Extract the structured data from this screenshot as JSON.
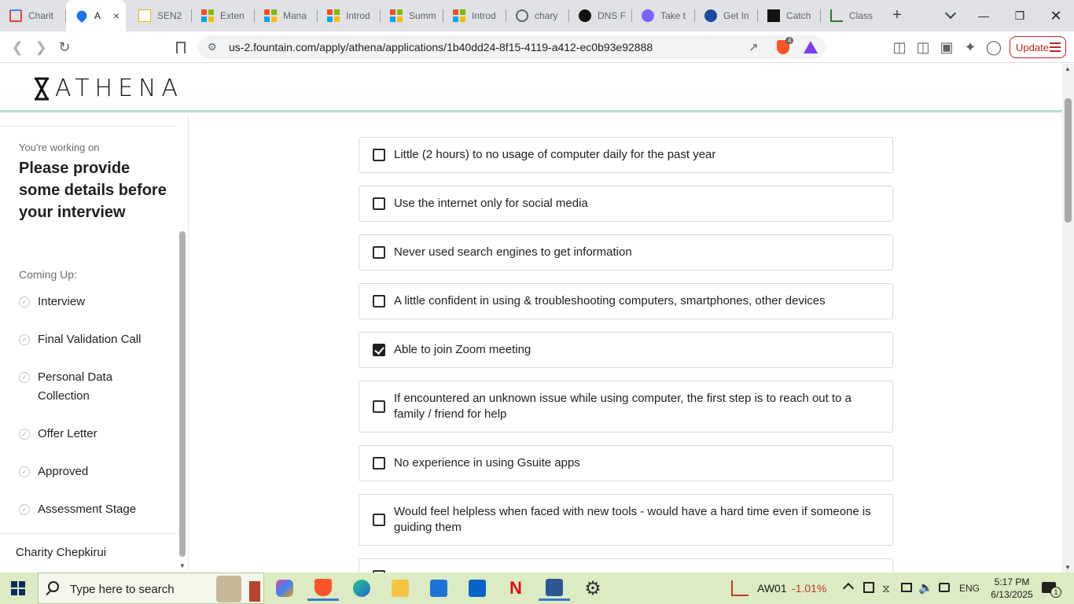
{
  "browser": {
    "tabs": [
      {
        "title": "Charit",
        "icon": "gmail-icon",
        "active": false
      },
      {
        "title": "A",
        "icon": "fountain-icon",
        "active": true
      },
      {
        "title": "SEN2",
        "icon": "slides-icon",
        "active": false
      },
      {
        "title": "Exten",
        "icon": "microsoft-icon",
        "active": false
      },
      {
        "title": "Mana",
        "icon": "microsoft-icon",
        "active": false
      },
      {
        "title": "Introd",
        "icon": "microsoft-icon",
        "active": false
      },
      {
        "title": "Summ",
        "icon": "microsoft-icon",
        "active": false
      },
      {
        "title": "Introd",
        "icon": "microsoft-icon",
        "active": false
      },
      {
        "title": "chary",
        "icon": "globe-icon",
        "active": false
      },
      {
        "title": "DNS F",
        "icon": "openai-icon",
        "active": false
      },
      {
        "title": "Take t",
        "icon": "purple-circle-icon",
        "active": false
      },
      {
        "title": "Get In",
        "icon": "edge-icon",
        "active": false
      },
      {
        "title": "Catch",
        "icon": "catch-icon",
        "active": false
      },
      {
        "title": "Class",
        "icon": "chart-icon",
        "active": false
      }
    ],
    "url": "us-2.fountain.com/apply/athena/applications/1b40dd24-8f15-4119-a412-ec0b93e92888",
    "update_label": "Update",
    "brave_badge": "4",
    "new_tab": "+",
    "close_tab": "×"
  },
  "site": {
    "logo_text": "ATHENA"
  },
  "sidebar": {
    "working_label": "You're working on",
    "working_title": "Please provide some details before your interview",
    "coming_label": "Coming Up:",
    "steps": [
      {
        "label": "Interview"
      },
      {
        "label": "Final Validation Call"
      },
      {
        "label": "Personal Data Collection"
      },
      {
        "label": "Offer Letter"
      },
      {
        "label": "Approved"
      },
      {
        "label": "Assessment Stage"
      }
    ],
    "user_name": "Charity Chepkirui"
  },
  "options": [
    {
      "label": "Little (2 hours) to no usage of computer daily for the past year",
      "checked": false
    },
    {
      "label": "Use the internet only for social media",
      "checked": false
    },
    {
      "label": "Never used search engines to get information",
      "checked": false
    },
    {
      "label": "A little confident in using & troubleshooting computers, smartphones, other devices",
      "checked": false
    },
    {
      "label": "Able to join Zoom meeting",
      "checked": true
    },
    {
      "label": "If encountered an unknown issue while using computer, the first step is to reach out to a family / friend for help",
      "checked": false
    },
    {
      "label": "No experience in using Gsuite apps",
      "checked": false
    },
    {
      "label": "Would feel helpless when faced with new tools - would have a hard time even if someone is guiding them",
      "checked": false
    }
  ],
  "taskbar": {
    "search_placeholder": "Type here to search",
    "stock_label": "AW01",
    "stock_change": "-1.01%",
    "language": "ENG",
    "time": "5:17 PM",
    "date": "6/13/2025",
    "notification_count": "1"
  }
}
